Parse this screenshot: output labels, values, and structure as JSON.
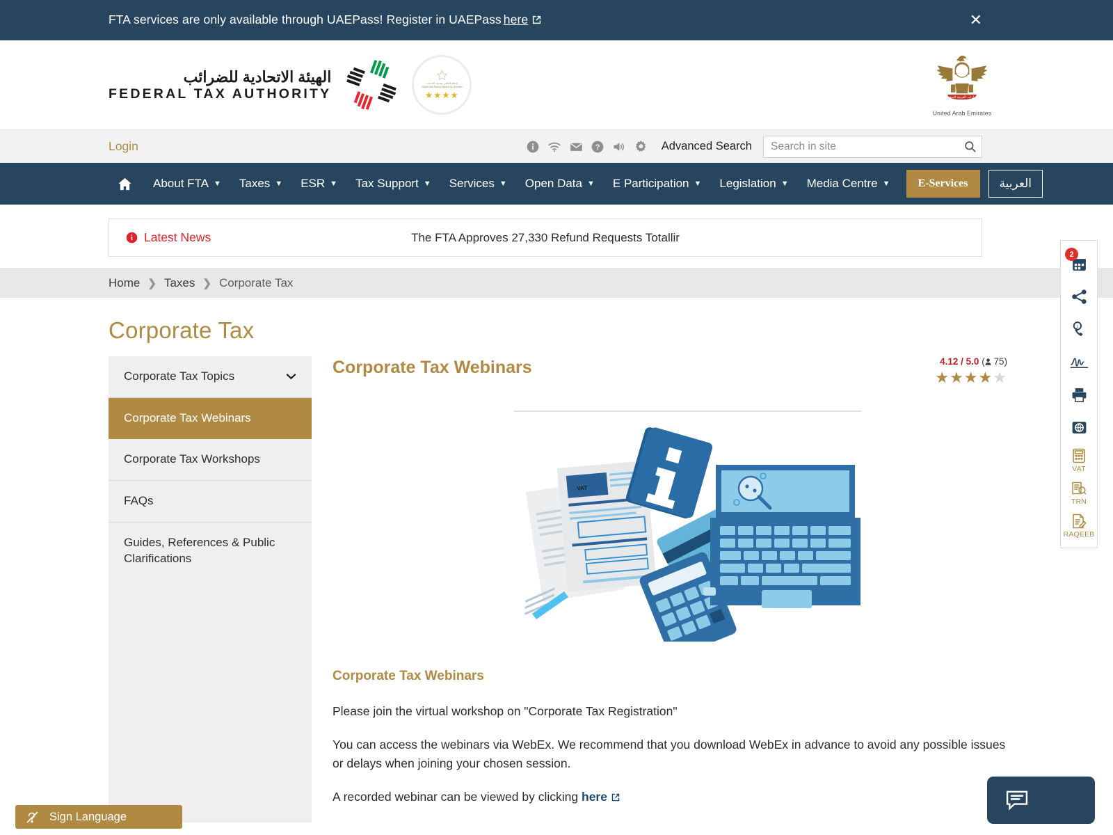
{
  "alert": {
    "message": "FTA services are only available through UAEPass! Register in UAEPass",
    "link_label": "here",
    "close_label": "✕"
  },
  "branding": {
    "fta_arabic": "الهيئة الاتحادية للضرائب",
    "fta_english": "FEDERAL TAX AUTHORITY",
    "badge_arabic": "النظام العالمي لتصنيف الخدمات",
    "badge_english": "Global Star Rating System for Services",
    "badge_stars": "★★★★",
    "emblem_caption": "United Arab Emirates"
  },
  "utility": {
    "login_label": "Login",
    "icons": [
      "info-icon",
      "wifi-icon",
      "envelope-icon",
      "question-icon",
      "speaker-icon",
      "gear-icon"
    ],
    "advanced_search_label": "Advanced Search",
    "search_placeholder": "Search in site",
    "search_value": ""
  },
  "nav": {
    "home_icon": "home-icon",
    "items": [
      {
        "label": "About FTA",
        "has_caret": true
      },
      {
        "label": "Taxes",
        "has_caret": true
      },
      {
        "label": "ESR",
        "has_caret": true
      },
      {
        "label": "Tax Support",
        "has_caret": true
      },
      {
        "label": "Services",
        "has_caret": true
      },
      {
        "label": "Open Data",
        "has_caret": true
      },
      {
        "label": "E Participation",
        "has_caret": true
      },
      {
        "label": "Legislation",
        "has_caret": true
      },
      {
        "label": "Media Centre",
        "has_caret": true
      }
    ],
    "eservices_label": "E-Services",
    "arabic_label": "العربية"
  },
  "news": {
    "label": "Latest News",
    "headline": "The FTA Approves 27,330 Refund Requests Totallir"
  },
  "breadcrumb": {
    "items": [
      "Home",
      "Taxes",
      "Corporate Tax"
    ],
    "separator": "❯"
  },
  "page": {
    "title": "Corporate Tax"
  },
  "sidebar": {
    "items": [
      {
        "label": "Corporate Tax Topics",
        "active": false,
        "expandable": true
      },
      {
        "label": "Corporate Tax Webinars",
        "active": true,
        "expandable": false
      },
      {
        "label": "Corporate Tax Workshops",
        "active": false,
        "expandable": false
      },
      {
        "label": "FAQs",
        "active": false,
        "expandable": false
      },
      {
        "label": "Guides, References & Public Clarifications",
        "active": false,
        "expandable": false
      }
    ]
  },
  "content": {
    "heading": "Corporate Tax Webinars",
    "rating_value": "4.12 / 5.0",
    "rating_count": "75",
    "stars_filled": 4,
    "stars_total": 5,
    "article_heading": "Corporate Tax Webinars",
    "paragraph_1": "Please join the virtual workshop on \"Corporate Tax Registration\"",
    "paragraph_2": "You can access the webinars via WebEx. We recommend that you download WebEx in advance to avoid any possible issues or delays when joining your chosen session.",
    "paragraph_3_prefix": "A recorded webinar can be viewed by clicking",
    "paragraph_3_link": "here"
  },
  "rail": {
    "badge_count": "2",
    "items": [
      {
        "icon": "calendar-icon",
        "label": "",
        "badge": "2"
      },
      {
        "icon": "share-icon",
        "label": ""
      },
      {
        "icon": "support-phone-icon",
        "label": ""
      },
      {
        "icon": "signature-icon",
        "label": ""
      },
      {
        "icon": "print-icon",
        "label": ""
      },
      {
        "icon": "globe-icon",
        "label": ""
      },
      {
        "icon": "vat-calculator-icon",
        "label": "VAT"
      },
      {
        "icon": "trn-verify-icon",
        "label": "TRN"
      },
      {
        "icon": "raqeeb-icon",
        "label": "RAQEEB"
      }
    ]
  },
  "widgets": {
    "sign_language_label": "Sign Language",
    "sign_language_icon": "hearing-impaired-icon",
    "chat_icon": "chat-bubble-icon"
  },
  "colors": {
    "navy": "#27455f",
    "gold": "#b08a43",
    "red": "#e4222b",
    "link_blue": "#1d4a73"
  }
}
